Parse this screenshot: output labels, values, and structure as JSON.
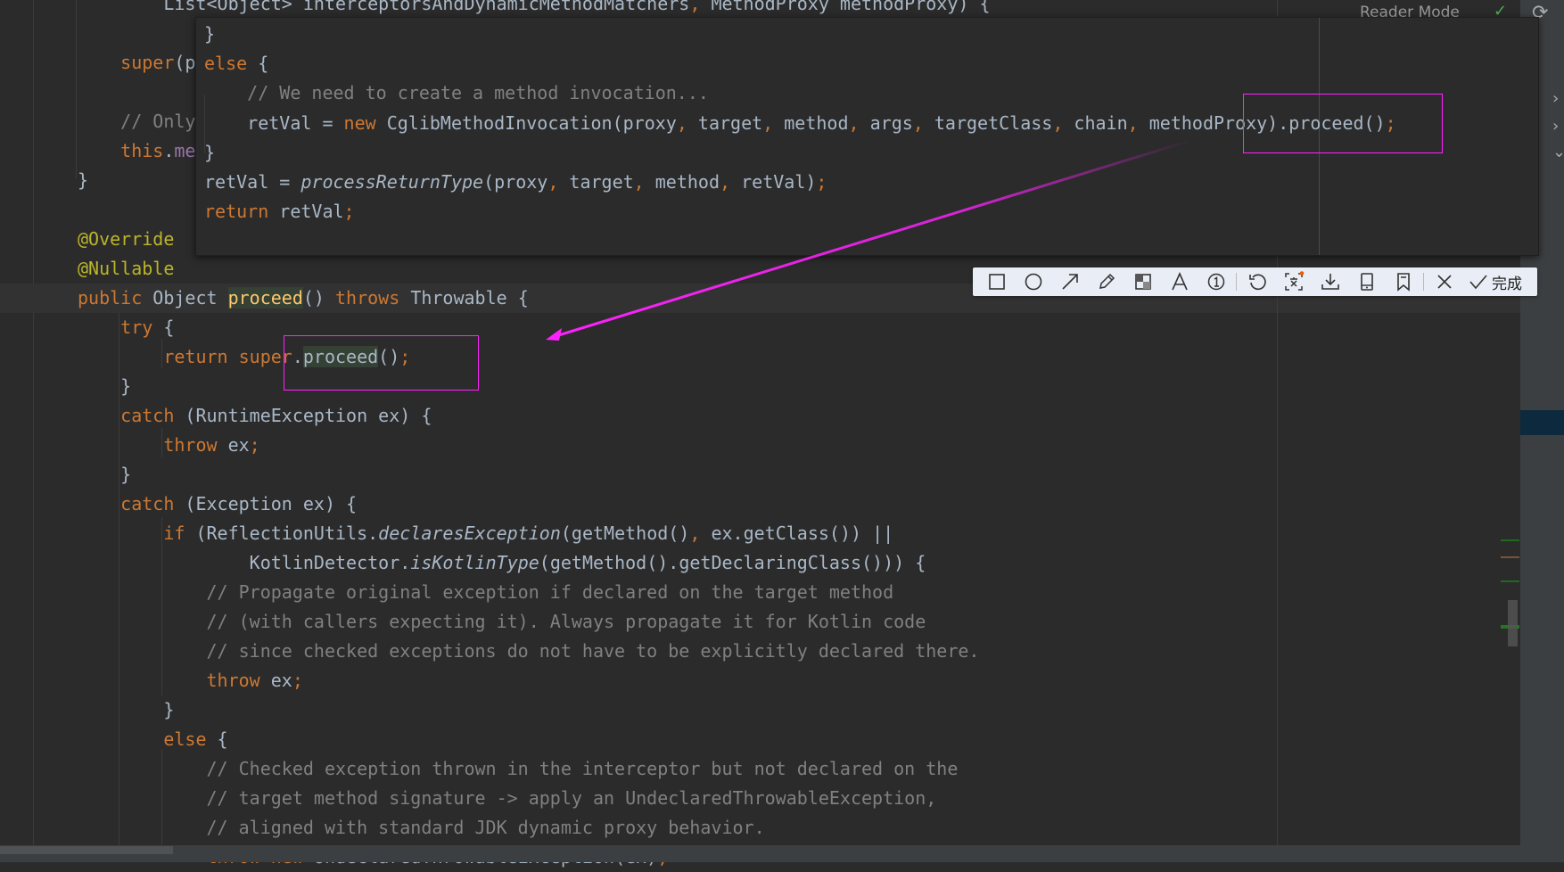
{
  "editor": {
    "lines": [
      [
        [
          "        List<Object> interceptorsAndDynamicMethodMatchers",
          "tx"
        ],
        [
          ", ",
          "kw"
        ],
        [
          "MethodProxy methodProxy) {",
          "tx"
        ]
      ],
      [],
      [
        [
          "    super",
          "kw"
        ],
        [
          "(p",
          "tx"
        ]
      ],
      [],
      [
        [
          "    // Only",
          "cm"
        ]
      ],
      [
        [
          "    this",
          "kw"
        ],
        [
          ".",
          "tx"
        ],
        [
          "me",
          "fd"
        ]
      ],
      [
        [
          "}",
          "tx"
        ]
      ],
      [],
      [
        [
          "@Override",
          "an"
        ]
      ],
      [
        [
          "@Nullable",
          "an"
        ]
      ],
      [
        [
          "public ",
          "kw"
        ],
        [
          "Object ",
          "tx"
        ],
        [
          "proceed",
          "fn hl"
        ],
        [
          "() ",
          "tx"
        ],
        [
          "throws ",
          "kw"
        ],
        [
          "Throwable {",
          "tx"
        ]
      ],
      [
        [
          "    try ",
          "kw"
        ],
        [
          "{",
          "tx"
        ]
      ],
      [
        [
          "        return super",
          "kw"
        ],
        [
          ".",
          "tx"
        ],
        [
          "proceed",
          "tx hl"
        ],
        [
          "()",
          "tx"
        ],
        [
          ";",
          "kw"
        ]
      ],
      [
        [
          "    }",
          "tx"
        ]
      ],
      [
        [
          "    catch ",
          "kw"
        ],
        [
          "(RuntimeException ex) {",
          "tx"
        ]
      ],
      [
        [
          "        throw ",
          "kw"
        ],
        [
          "ex",
          "tx"
        ],
        [
          ";",
          "kw"
        ]
      ],
      [
        [
          "    }",
          "tx"
        ]
      ],
      [
        [
          "    catch ",
          "kw"
        ],
        [
          "(Exception ex) {",
          "tx"
        ]
      ],
      [
        [
          "        if ",
          "kw"
        ],
        [
          "(ReflectionUtils.",
          "tx"
        ],
        [
          "declaresException",
          "it"
        ],
        [
          "(getMethod()",
          "tx"
        ],
        [
          ", ",
          "kw"
        ],
        [
          "ex.getClass()) ||",
          "tx"
        ]
      ],
      [
        [
          "                KotlinDetector.",
          "tx"
        ],
        [
          "isKotlinType",
          "it"
        ],
        [
          "(getMethod().getDeclaringClass())) {",
          "tx"
        ]
      ],
      [
        [
          "            // Propagate original exception if declared on the target method",
          "cm"
        ]
      ],
      [
        [
          "            // (with callers expecting it). Always propagate it for Kotlin code",
          "cm"
        ]
      ],
      [
        [
          "            // since checked exceptions do not have to be explicitly declared there.",
          "cm"
        ]
      ],
      [
        [
          "            throw ",
          "kw"
        ],
        [
          "ex",
          "tx"
        ],
        [
          ";",
          "kw"
        ]
      ],
      [
        [
          "        }",
          "tx"
        ]
      ],
      [
        [
          "        else ",
          "kw"
        ],
        [
          "{",
          "tx"
        ]
      ],
      [
        [
          "            // Checked exception thrown in the interceptor but not declared on the",
          "cm"
        ]
      ],
      [
        [
          "            // target method signature -> apply an UndeclaredThrowableException,",
          "cm"
        ]
      ],
      [
        [
          "            // aligned with standard JDK dynamic proxy behavior.",
          "cm"
        ]
      ],
      [
        [
          "            throw new ",
          "kw"
        ],
        [
          "UndeclaredThrowableException(ex)",
          "tx"
        ],
        [
          ";",
          "kw"
        ]
      ]
    ]
  },
  "popup": {
    "lines": [
      [
        [
          "}",
          "tx"
        ]
      ],
      [
        [
          "else ",
          "kw"
        ],
        [
          "{",
          "tx"
        ]
      ],
      [
        [
          "    // We need to create a method invocation...",
          "cm"
        ]
      ],
      [
        [
          "    retVal = ",
          "tx"
        ],
        [
          "new ",
          "kw"
        ],
        [
          "CglibMethodInvocation(proxy",
          "tx"
        ],
        [
          ", ",
          "kw"
        ],
        [
          "target",
          "tx"
        ],
        [
          ", ",
          "kw"
        ],
        [
          "method",
          "tx"
        ],
        [
          ", ",
          "kw"
        ],
        [
          "args",
          "tx"
        ],
        [
          ", ",
          "kw"
        ],
        [
          "targetClass",
          "tx"
        ],
        [
          ", ",
          "kw"
        ],
        [
          "chain",
          "tx"
        ],
        [
          ", ",
          "kw"
        ],
        [
          "methodProxy).proceed()",
          "tx"
        ],
        [
          ";",
          "kw"
        ]
      ],
      [
        [
          "}",
          "tx"
        ]
      ],
      [
        [
          "retVal = ",
          "tx"
        ],
        [
          "processReturnType",
          "it"
        ],
        [
          "(proxy",
          "tx"
        ],
        [
          ", ",
          "kw"
        ],
        [
          "target",
          "tx"
        ],
        [
          ", ",
          "kw"
        ],
        [
          "method",
          "tx"
        ],
        [
          ", ",
          "kw"
        ],
        [
          "retVal)",
          "tx"
        ],
        [
          ";",
          "kw"
        ]
      ],
      [
        [
          "return ",
          "kw"
        ],
        [
          "retVal",
          "tx"
        ],
        [
          ";",
          "kw"
        ]
      ]
    ]
  },
  "top_bar": {
    "reader_mode": "Reader Mode",
    "status_icon": "check-icon",
    "refresh_icon": "refresh-icon"
  },
  "annotation": {
    "color": "#ff22ff"
  },
  "toolbar": {
    "tools": [
      "rectangle-icon",
      "ellipse-icon",
      "arrow-icon",
      "pencil-icon",
      "mosaic-icon",
      "text-icon",
      "number-icon",
      "undo-icon",
      "ocr-icon",
      "download-icon",
      "pin-icon",
      "bookmark-icon",
      "close-icon"
    ],
    "done_label": "完成"
  },
  "colors": {
    "background": "#2b2b2b",
    "keyword": "#cc7832",
    "comment": "#808080",
    "annotation": "#bbb529",
    "declaration": "#ffc66d",
    "text": "#a9b7c6"
  }
}
